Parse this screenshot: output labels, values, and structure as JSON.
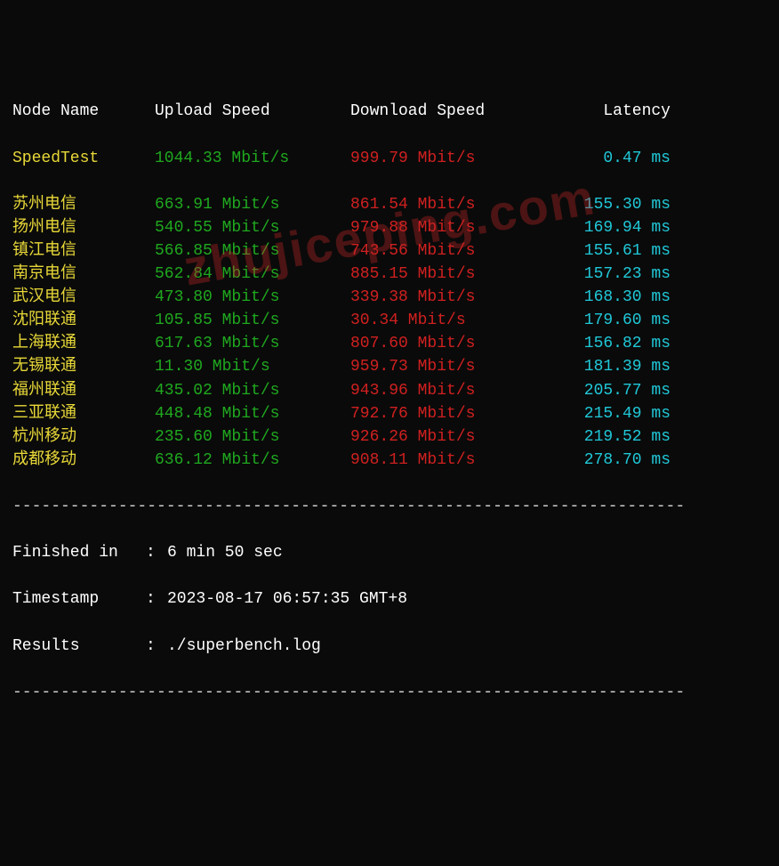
{
  "header": {
    "node": "Node Name",
    "upload": "Upload Speed",
    "download": "Download Speed",
    "latency": "Latency"
  },
  "speedtest_row": {
    "node": "SpeedTest",
    "upload": "1044.33 Mbit/s",
    "download": "999.79 Mbit/s",
    "latency": "0.47 ms"
  },
  "rows": [
    {
      "node": "苏州电信",
      "upload": "663.91 Mbit/s",
      "download": "861.54 Mbit/s",
      "latency": "155.30 ms"
    },
    {
      "node": "扬州电信",
      "upload": "540.55 Mbit/s",
      "download": "979.88 Mbit/s",
      "latency": "169.94 ms"
    },
    {
      "node": "镇江电信",
      "upload": "566.85 Mbit/s",
      "download": "743.56 Mbit/s",
      "latency": "155.61 ms"
    },
    {
      "node": "南京电信",
      "upload": "562.84 Mbit/s",
      "download": "885.15 Mbit/s",
      "latency": "157.23 ms"
    },
    {
      "node": "武汉电信",
      "upload": "473.80 Mbit/s",
      "download": "339.38 Mbit/s",
      "latency": "168.30 ms"
    },
    {
      "node": "沈阳联通",
      "upload": "105.85 Mbit/s",
      "download": "30.34 Mbit/s",
      "latency": "179.60 ms"
    },
    {
      "node": "上海联通",
      "upload": "617.63 Mbit/s",
      "download": "807.60 Mbit/s",
      "latency": "156.82 ms"
    },
    {
      "node": "无锡联通",
      "upload": "11.30 Mbit/s",
      "download": "959.73 Mbit/s",
      "latency": "181.39 ms"
    },
    {
      "node": "福州联通",
      "upload": "435.02 Mbit/s",
      "download": "943.96 Mbit/s",
      "latency": "205.77 ms"
    },
    {
      "node": "三亚联通",
      "upload": "448.48 Mbit/s",
      "download": "792.76 Mbit/s",
      "latency": "215.49 ms"
    },
    {
      "node": "杭州移动",
      "upload": "235.60 Mbit/s",
      "download": "926.26 Mbit/s",
      "latency": "219.52 ms"
    },
    {
      "node": "成都移动",
      "upload": "636.12 Mbit/s",
      "download": "908.11 Mbit/s",
      "latency": "278.70 ms"
    }
  ],
  "divider": "----------------------------------------------------------------------",
  "footer": {
    "finished_label": "Finished in",
    "finished_value": "6 min 50 sec",
    "timestamp_label": "Timestamp",
    "timestamp_value": "2023-08-17 06:57:35 GMT+8",
    "results_label": "Results",
    "results_value": "./superbench.log",
    "colon": ":"
  },
  "watermark": "zhujiceping.com"
}
